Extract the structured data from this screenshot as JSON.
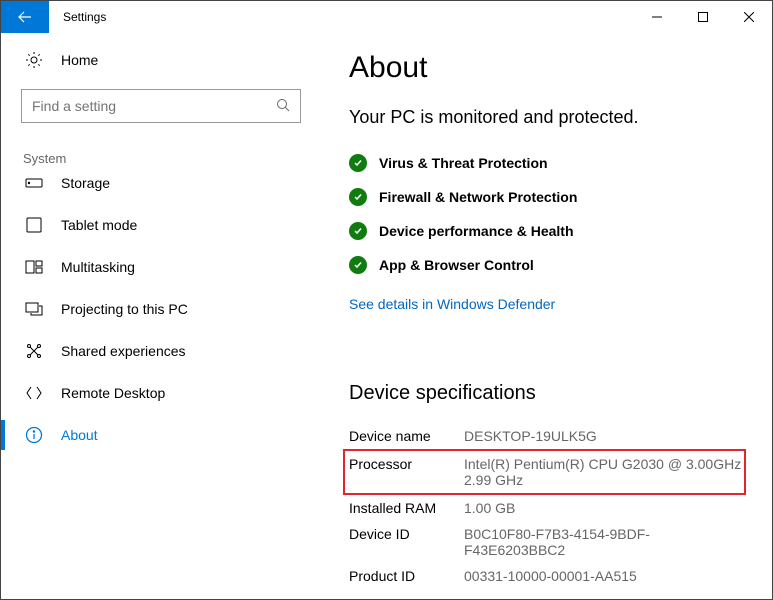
{
  "window": {
    "title": "Settings"
  },
  "sidebar": {
    "home_label": "Home",
    "search_placeholder": "Find a setting",
    "group_label": "System",
    "items": [
      {
        "label": "Storage",
        "icon": "storage-icon"
      },
      {
        "label": "Tablet mode",
        "icon": "tablet-icon"
      },
      {
        "label": "Multitasking",
        "icon": "multitask-icon"
      },
      {
        "label": "Projecting to this PC",
        "icon": "project-icon"
      },
      {
        "label": "Shared experiences",
        "icon": "shared-icon"
      },
      {
        "label": "Remote Desktop",
        "icon": "remote-icon"
      },
      {
        "label": "About",
        "icon": "info-icon"
      }
    ]
  },
  "main": {
    "title": "About",
    "subtitle": "Your PC is monitored and protected.",
    "protection": [
      "Virus & Threat Protection",
      "Firewall & Network Protection",
      "Device performance & Health",
      "App & Browser Control"
    ],
    "details_link": "See details in Windows Defender",
    "spec_title": "Device specifications",
    "specs": [
      {
        "label": "Device name",
        "value": "DESKTOP-19ULK5G"
      },
      {
        "label": "Processor",
        "value": "Intel(R) Pentium(R) CPU G2030 @ 3.00GHz   2.99 GHz"
      },
      {
        "label": "Installed RAM",
        "value": "1.00 GB"
      },
      {
        "label": "Device ID",
        "value": "B0C10F80-F7B3-4154-9BDF-F43E6203BBC2"
      },
      {
        "label": "Product ID",
        "value": "00331-10000-00001-AA515"
      }
    ]
  }
}
